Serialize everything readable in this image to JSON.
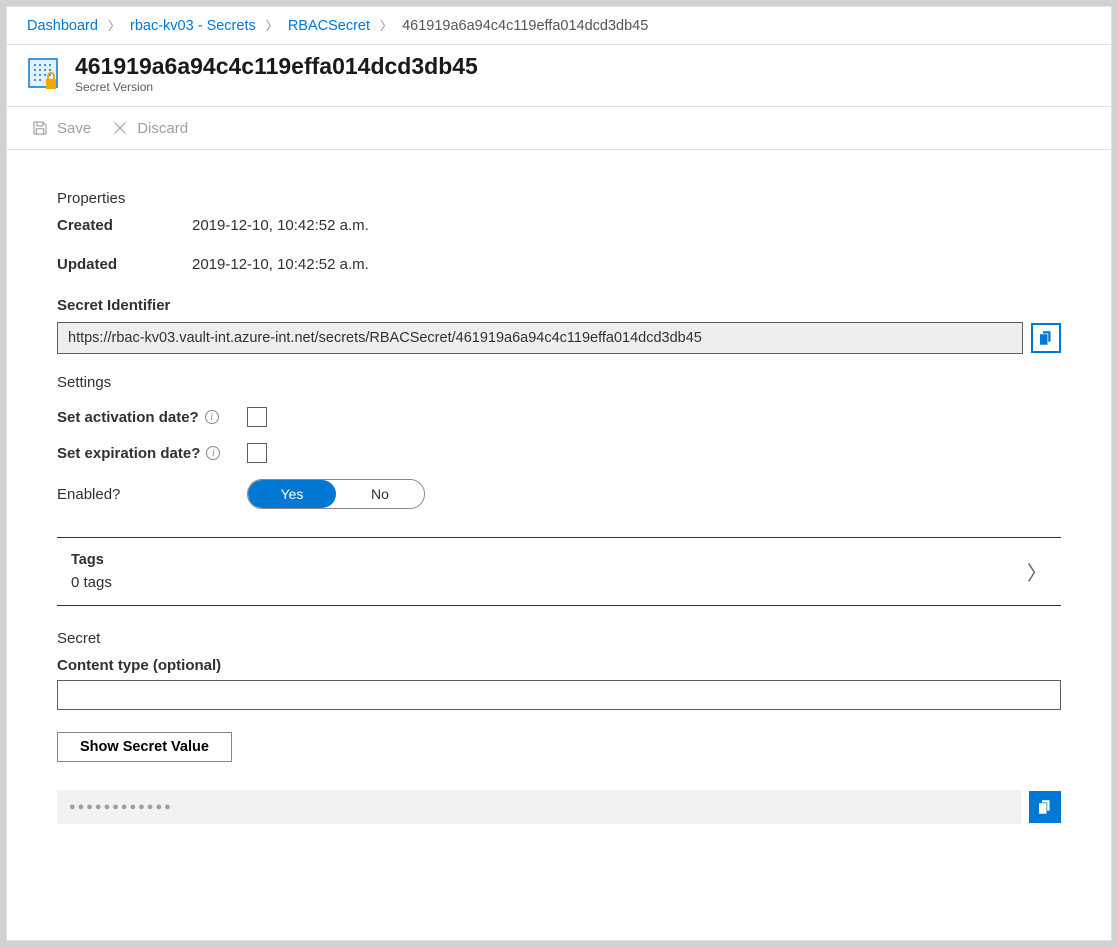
{
  "breadcrumb": {
    "items": [
      "Dashboard",
      "rbac-kv03 - Secrets",
      "RBACSecret"
    ],
    "current": "461919a6a94c4c119effa014dcd3db45"
  },
  "header": {
    "title": "461919a6a94c4c119effa014dcd3db45",
    "subtitle": "Secret Version"
  },
  "toolbar": {
    "save_label": "Save",
    "discard_label": "Discard"
  },
  "properties": {
    "section_title": "Properties",
    "created_label": "Created",
    "created_value": "2019-12-10, 10:42:52 a.m.",
    "updated_label": "Updated",
    "updated_value": "2019-12-10, 10:42:52 a.m.",
    "identifier_label": "Secret Identifier",
    "identifier_value": "https://rbac-kv03.vault-int.azure-int.net/secrets/RBACSecret/461919a6a94c4c119effa014dcd3db45"
  },
  "settings": {
    "section_title": "Settings",
    "activation_label": "Set activation date?",
    "expiration_label": "Set expiration date?",
    "enabled_label": "Enabled?",
    "enabled_yes": "Yes",
    "enabled_no": "No"
  },
  "tags": {
    "title": "Tags",
    "count": "0 tags"
  },
  "secret": {
    "section_title": "Secret",
    "content_type_label": "Content type (optional)",
    "content_type_value": "",
    "show_button": "Show Secret Value",
    "masked_value": "●●●●●●●●●●●●"
  }
}
